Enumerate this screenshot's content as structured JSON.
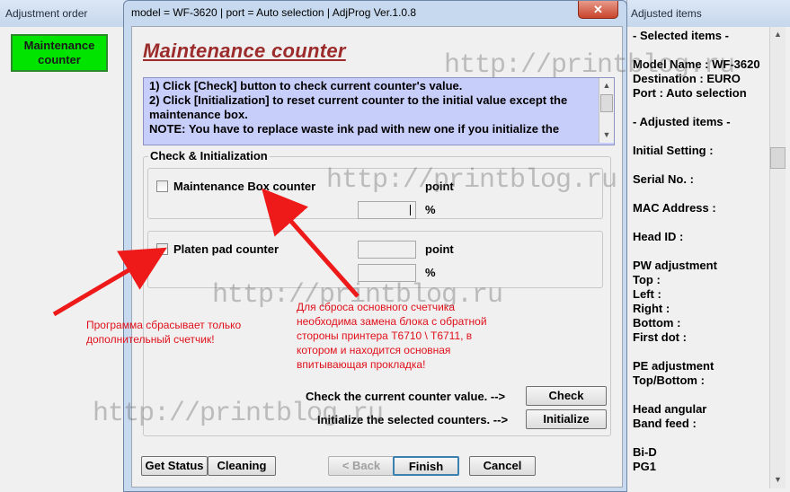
{
  "left_window": {
    "title": "Adjustment order",
    "selected_item": "Maintenance counter"
  },
  "main_window": {
    "title": "model = WF-3620 | port = Auto selection | AdjProg Ver.1.0.8",
    "close_label": "✕",
    "page_title": "Maintenance counter",
    "instructions": [
      "1) Click [Check] button to check current counter's value.",
      "2) Click [Initialization] to reset current counter to the initial value except the maintenance box.",
      "NOTE: You have to replace waste ink pad with new one if you initialize the"
    ],
    "group_label": "Check & Initialization",
    "counters": [
      {
        "label": "Maintenance Box counter",
        "point_unit": "point",
        "percent_unit": "%",
        "checked": false
      },
      {
        "label": "Platen pad counter",
        "point_unit": "point",
        "percent_unit": "%",
        "checked": false
      }
    ],
    "check_row_label": "Check the current counter value. -->",
    "check_button": "Check",
    "init_row_label": "Initialize the selected counters. -->",
    "init_button": "Initialize",
    "footer": {
      "get_status": "Get Status",
      "cleaning": "Cleaning",
      "back": "< Back",
      "finish": "Finish",
      "cancel": "Cancel"
    }
  },
  "right_window": {
    "title": "Adjusted items",
    "lines": [
      "- Selected items -",
      "",
      "Model Name : WF-3620",
      "Destination : EURO",
      "Port : Auto selection",
      "",
      "- Adjusted items -",
      "",
      "Initial Setting :",
      "",
      "Serial No. :",
      "",
      "MAC Address :",
      "",
      "Head ID :",
      "",
      "PW adjustment",
      "Top :",
      "Left :",
      "Right :",
      "Bottom :",
      "First dot :",
      "",
      "PE adjustment",
      "Top/Bottom :",
      "",
      "Head angular",
      " Band feed :",
      "",
      "Bi-D",
      "PG1"
    ]
  },
  "annotations": {
    "note_left": "Программа сбрасывает только дополнительный счетчик!",
    "note_right": "Для сброса основного счетчика необходима замена блока с обратной стороны принтера T6710 \\ T6711, в котором и находится основная впитывающая прокладка!",
    "watermark": "http://printblog.ru",
    "arrow_color": "#ee1a1a"
  }
}
